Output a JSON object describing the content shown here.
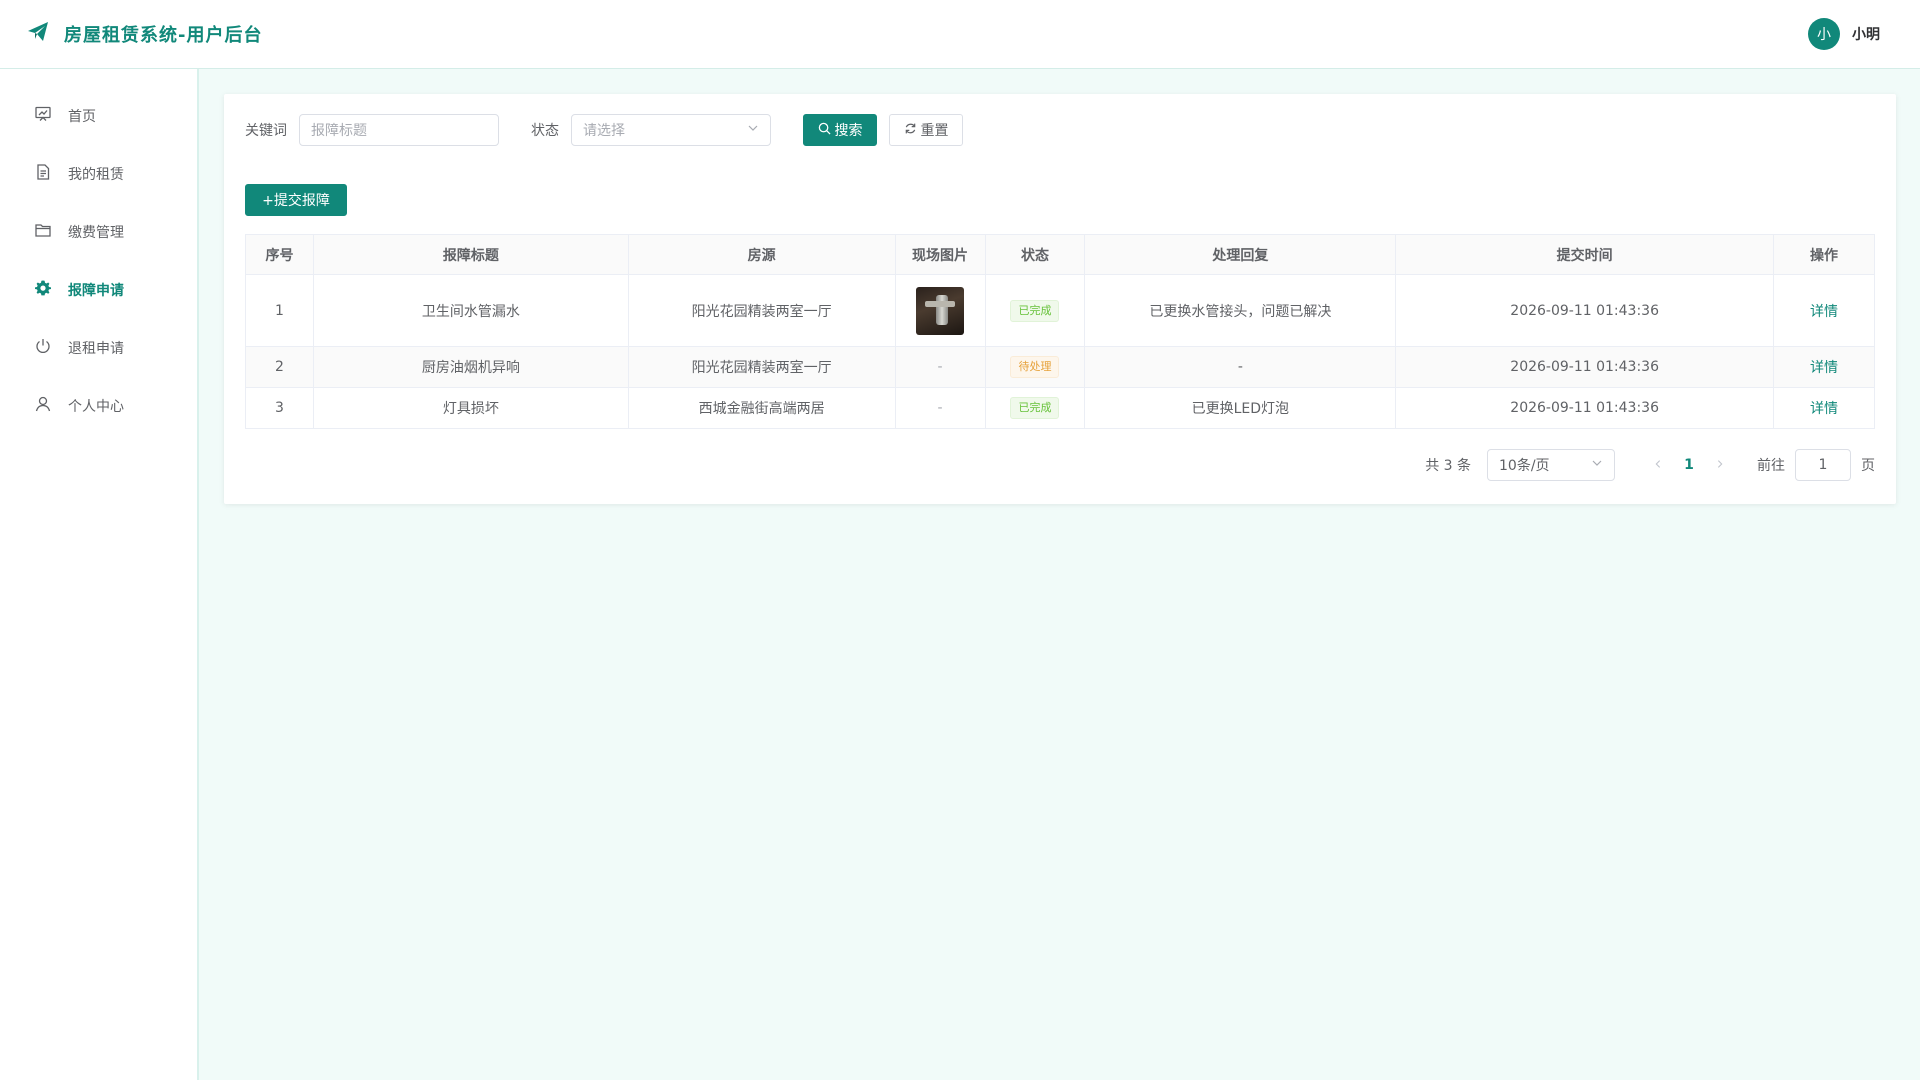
{
  "header": {
    "title": "房屋租赁系统-用户后台",
    "brand_icon": "paper-plane-icon",
    "avatar_text": "小",
    "user_name": "小明",
    "accent": "#11887a"
  },
  "sidebar": {
    "items": [
      {
        "label": "首页",
        "icon": "dashboard-icon"
      },
      {
        "label": "我的租赁",
        "icon": "document-icon"
      },
      {
        "label": "缴费管理",
        "icon": "folder-icon"
      },
      {
        "label": "报障申请",
        "icon": "gear-icon"
      },
      {
        "label": "退租申请",
        "icon": "power-icon"
      },
      {
        "label": "个人中心",
        "icon": "user-icon"
      }
    ],
    "active_index": 3
  },
  "filters": {
    "keyword_label": "关键词",
    "keyword_placeholder": "报障标题",
    "status_label": "状态",
    "status_placeholder": "请选择",
    "search_label": "搜索",
    "reset_label": "重置"
  },
  "add_button_label": "+提交报障",
  "table": {
    "columns": [
      "序号",
      "报障标题",
      "房源",
      "现场图片",
      "状态",
      "处理回复",
      "提交时间",
      "操作"
    ],
    "rows": [
      {
        "index": "1",
        "title": "卫生间水管漏水",
        "property": "阳光花园精装两室一厅",
        "image": "photo",
        "status": "已完成",
        "reply": "已更换水管接头，问题已解决",
        "time": "2026-09-11 01:43:36",
        "action": "详情"
      },
      {
        "index": "2",
        "title": "厨房油烟机异响",
        "property": "阳光花园精装两室一厅",
        "image": "-",
        "status": "待处理",
        "reply": "-",
        "time": "2026-09-11 01:43:36",
        "action": "详情"
      },
      {
        "index": "3",
        "title": "灯具损坏",
        "property": "西城金融街高端两居",
        "image": "-",
        "status": "已完成",
        "reply": "已更换LED灯泡",
        "time": "2026-09-11 01:43:36",
        "action": "详情"
      }
    ]
  },
  "pagination": {
    "total_text": "共 3 条",
    "page_size": "10条/页",
    "current_page": "1",
    "goto_label": "前往",
    "goto_value": "1",
    "page_suffix": "页"
  }
}
